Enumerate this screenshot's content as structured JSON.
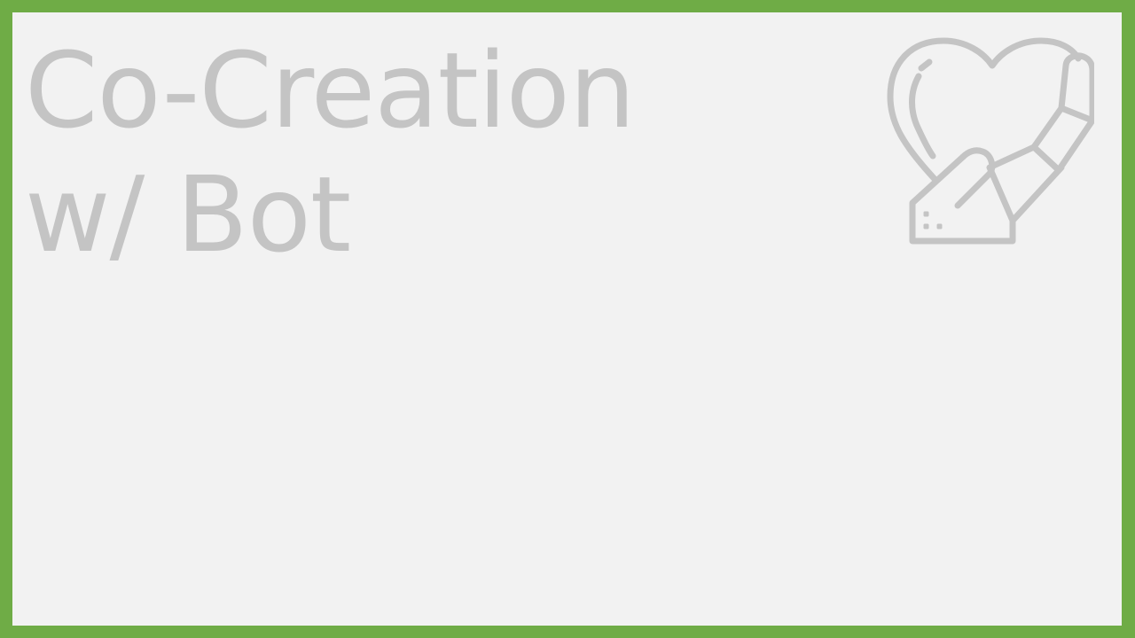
{
  "slide": {
    "title_lines": [
      "Co-Creation",
      "w/ Bot"
    ]
  },
  "colors": {
    "border": "#6fac46",
    "background": "#f2f2f2",
    "text": "#c4c4c4"
  },
  "logo": {
    "icon": "heart-robot-hand-icon"
  }
}
